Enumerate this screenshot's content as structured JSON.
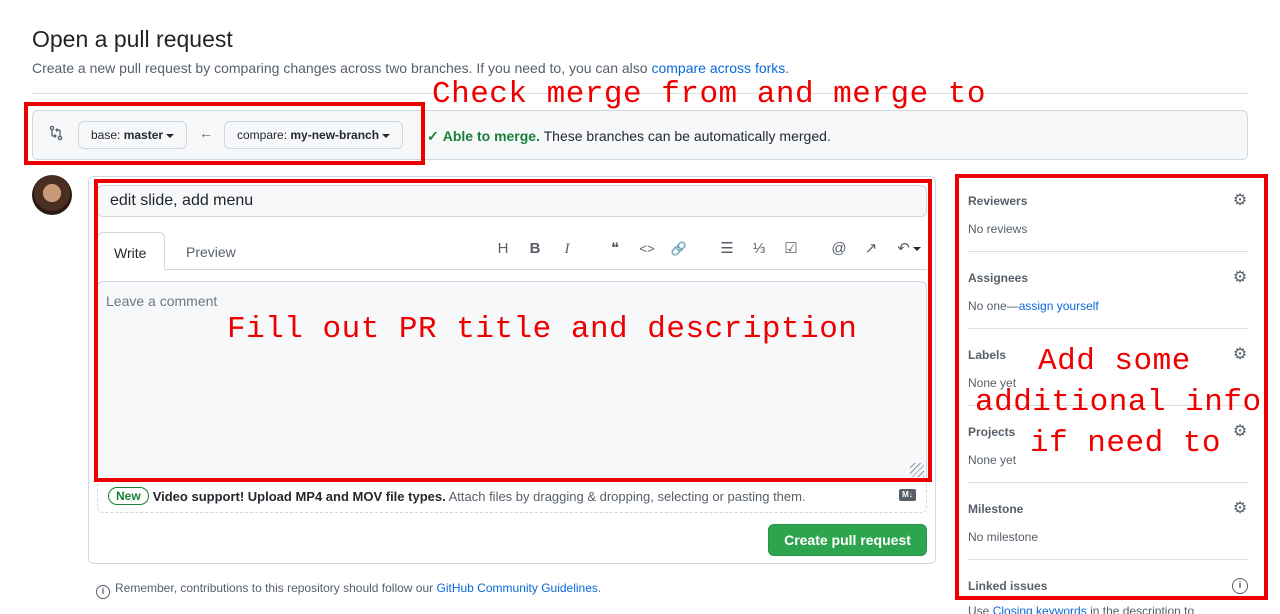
{
  "header": {
    "title": "Open a pull request",
    "subtitle": "Create a new pull request by comparing changes across two branches. If you need to, you can also ",
    "subtitle_link": "compare across forks",
    "subtitle_end": "."
  },
  "range": {
    "base_prefix": "base: ",
    "base_branch": "master",
    "compare_prefix": "compare: ",
    "compare_branch": "my-new-branch",
    "arrow": "←",
    "status_bold": "Able to merge.",
    "status_text": " These branches can be automatically merged.",
    "check": "✓"
  },
  "composer": {
    "title_value": "edit slide, add menu",
    "tabs": {
      "write": "Write",
      "preview": "Preview"
    },
    "toolbar": {
      "heading": "H",
      "bold": "B",
      "italic": "I",
      "quote": "❝",
      "code": "<>",
      "link": "🔗",
      "bullets": "☰",
      "numbered": "⅓",
      "tasks": "☑",
      "mention": "@",
      "reference": "↗",
      "reply": "↶"
    },
    "comment_placeholder": "Leave a comment",
    "upload_badge": "New",
    "upload_bold": "Video support! Upload MP4 and MOV file types.",
    "upload_text": " Attach files by dragging & dropping, selecting or pasting them.",
    "markdown_badge": "M↓",
    "create_button": "Create pull request",
    "guidelines_text": "Remember, contributions to this repository should follow our ",
    "guidelines_link": "GitHub Community Guidelines",
    "guidelines_end": "."
  },
  "sidebar": {
    "reviewers": {
      "label": "Reviewers",
      "value": "No reviews"
    },
    "assignees": {
      "label": "Assignees",
      "value": "No one—",
      "value_link": "assign yourself"
    },
    "labels": {
      "label": "Labels",
      "value": "None yet"
    },
    "projects": {
      "label": "Projects",
      "value": "None yet"
    },
    "milestone": {
      "label": "Milestone",
      "value": "No milestone"
    },
    "linked": {
      "label": "Linked issues",
      "value": "Use ",
      "value_link": "Closing keywords",
      "value_end": " in the description to"
    },
    "gear": "⚙",
    "info": "i"
  },
  "annotations": {
    "merge": "Check merge from and merge to",
    "title_desc": "Fill out PR title and description",
    "extra_line1": "Add some",
    "extra_line2": "additional info",
    "extra_line3": "if need to",
    "color": "#ee0000"
  },
  "colors": {
    "accent_green": "#2da44e",
    "link_blue": "#0969da",
    "success_green": "#1a7f37"
  }
}
